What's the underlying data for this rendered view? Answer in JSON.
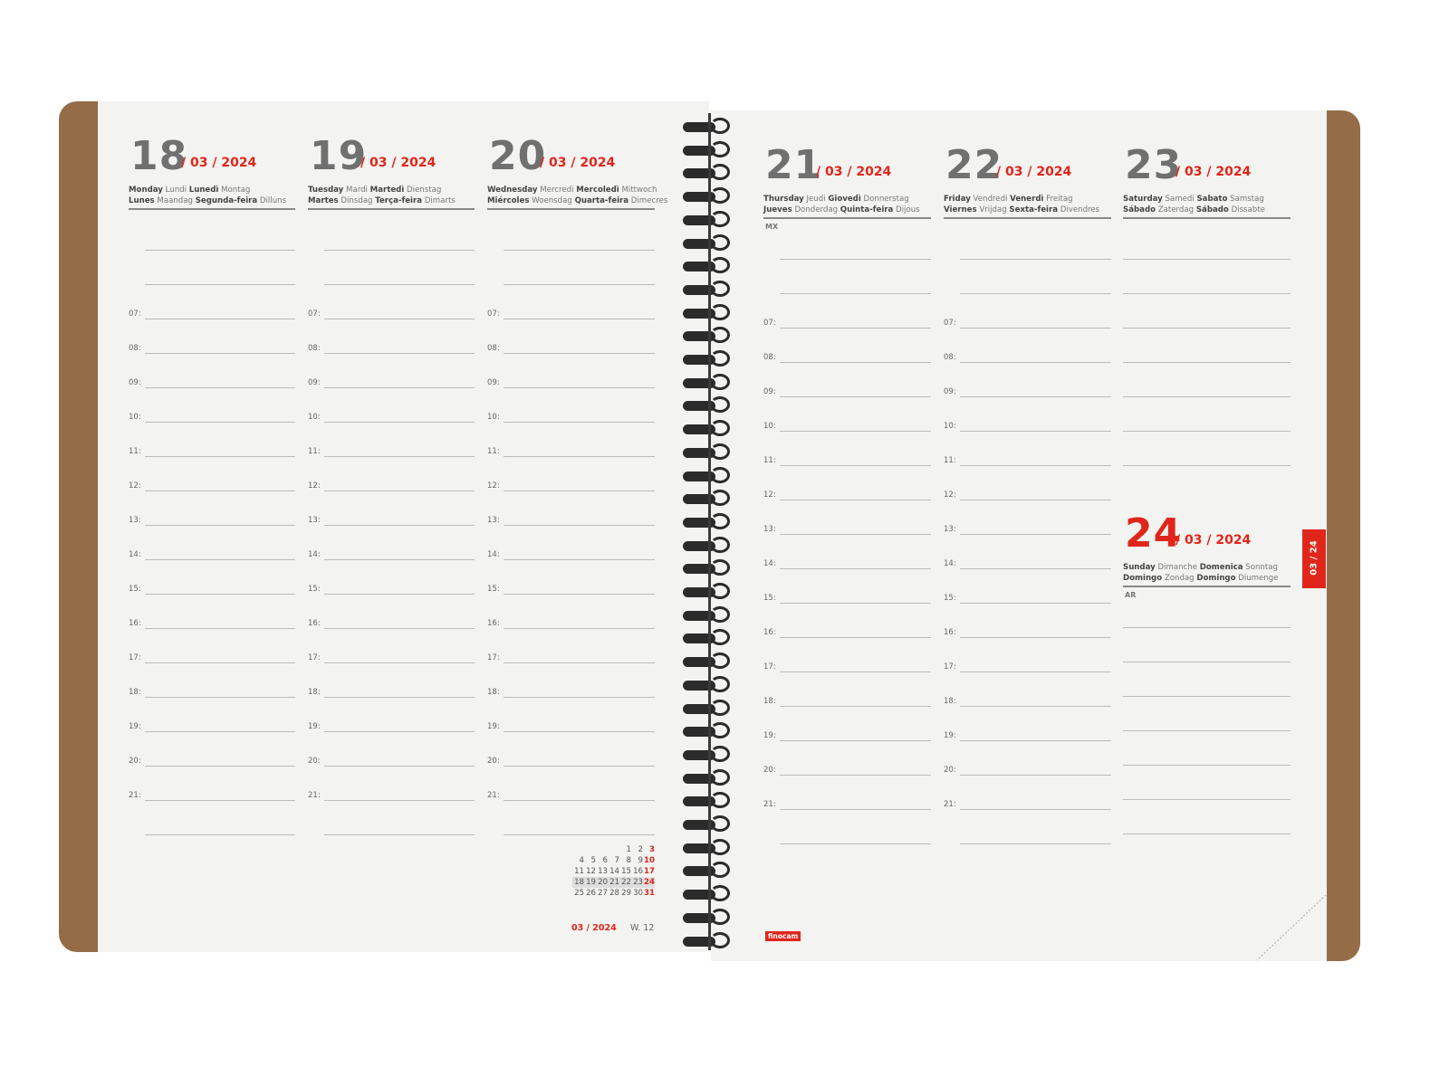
{
  "planner": {
    "days": [
      {
        "num": "18",
        "month": "/ 03 / 2024",
        "names": [
          [
            "Monday",
            "Lundi",
            "Lunedì",
            "Montag"
          ],
          [
            "Lunes",
            "Maandag",
            "Segunda-feira",
            "Dilluns"
          ]
        ],
        "abbr": ""
      },
      {
        "num": "19",
        "month": "/ 03 / 2024",
        "names": [
          [
            "Tuesday",
            "Mardi",
            "Martedì",
            "Dienstag"
          ],
          [
            "Martes",
            "Dinsdag",
            "Terça-feira",
            "Dimarts"
          ]
        ],
        "abbr": ""
      },
      {
        "num": "20",
        "month": "/ 03 / 2024",
        "names": [
          [
            "Wednesday",
            "Mercredi",
            "Mercoledì",
            "Mittwoch"
          ],
          [
            "Miércoles",
            "Woensdag",
            "Quarta-feira",
            "Dimecres"
          ]
        ],
        "abbr": ""
      },
      {
        "num": "21",
        "month": "/ 03 / 2024",
        "names": [
          [
            "Thursday",
            "Jeudi",
            "Giovedì",
            "Donnerstag"
          ],
          [
            "Jueves",
            "Donderdag",
            "Quinta-feira",
            "Dijous"
          ]
        ],
        "abbr": "MX"
      },
      {
        "num": "22",
        "month": "/ 03 / 2024",
        "names": [
          [
            "Friday",
            "Vendredi",
            "Venerdì",
            "Freitag"
          ],
          [
            "Viernes",
            "Vrijdag",
            "Sexta-feira",
            "Divendres"
          ]
        ],
        "abbr": ""
      },
      {
        "num": "23",
        "month": "/ 03 / 2024",
        "names": [
          [
            "Saturday",
            "Samedi",
            "Sabato",
            "Samstag"
          ],
          [
            "Sábado",
            "Zaterdag",
            "Sábado",
            "Dissabte"
          ]
        ],
        "abbr": ""
      },
      {
        "num": "24",
        "month": "/ 03 / 2024",
        "names": [
          [
            "Sunday",
            "Dimanche",
            "Domenica",
            "Sonntag"
          ],
          [
            "Domingo",
            "Zondag",
            "Domingo",
            "Diumenge"
          ]
        ],
        "abbr": "AR"
      }
    ],
    "hours": [
      "07:",
      "08:",
      "09:",
      "10:",
      "11:",
      "12:",
      "13:",
      "14:",
      "15:",
      "16:",
      "17:",
      "18:",
      "19:",
      "20:",
      "21:"
    ],
    "mini_calendar": {
      "rows": [
        [
          "",
          "",
          "",
          "",
          "1",
          "2",
          "3"
        ],
        [
          "4",
          "5",
          "6",
          "7",
          "8",
          "9",
          "10"
        ],
        [
          "11",
          "12",
          "13",
          "14",
          "15",
          "16",
          "17"
        ],
        [
          "18",
          "19",
          "20",
          "21",
          "22",
          "23",
          "24"
        ],
        [
          "25",
          "26",
          "27",
          "28",
          "29",
          "30",
          "31"
        ]
      ],
      "highlight_row": 3
    },
    "footer": {
      "date": "03 / 2024",
      "week": "W. 12"
    },
    "side_tab": "03 / 24",
    "brand": "finocam",
    "colors": {
      "accent": "#e0261b",
      "cover": "#946d47",
      "page": "#f3f3f1"
    }
  }
}
